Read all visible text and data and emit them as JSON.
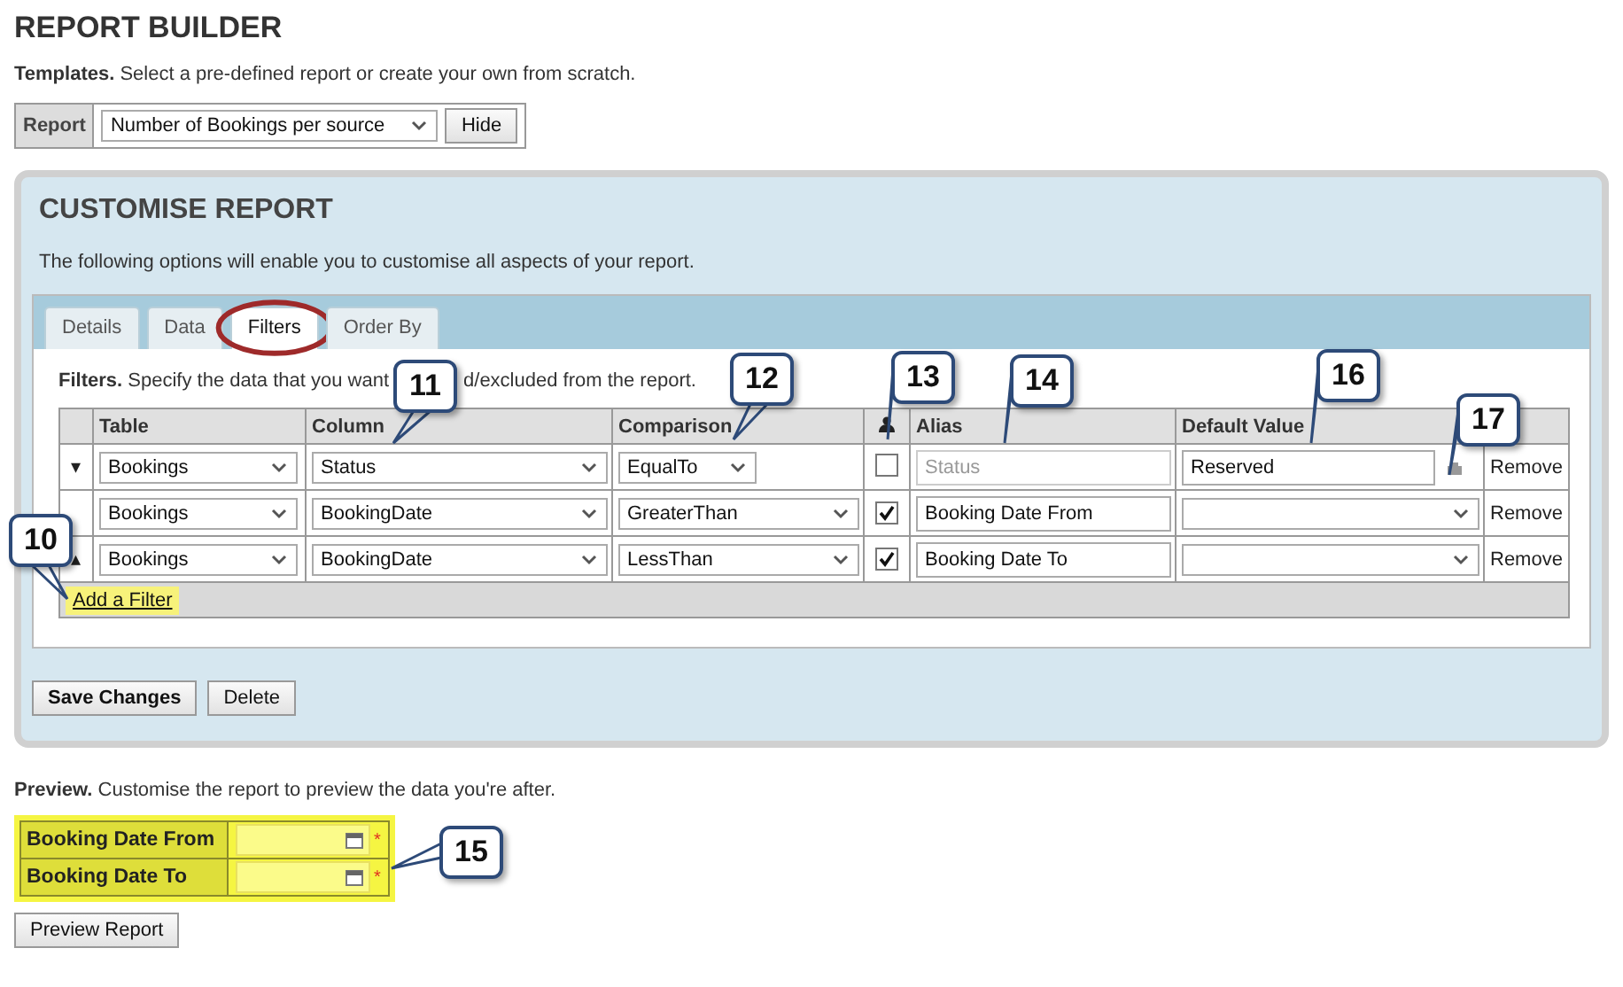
{
  "title": "REPORT BUILDER",
  "templates": {
    "heading": "Templates.",
    "text": "Select a pre-defined report or create your own from scratch.",
    "label": "Report",
    "value": "Number of Bookings per source",
    "button": "Hide"
  },
  "customise": {
    "title": "CUSTOMISE REPORT",
    "description": "The following options will enable you to customise all aspects of your report.",
    "tabs": [
      {
        "label": "Details",
        "selected": false
      },
      {
        "label": "Data",
        "selected": false
      },
      {
        "label": "Filters",
        "selected": true,
        "circled": true
      },
      {
        "label": "Order By",
        "selected": false,
        "circled": false
      }
    ],
    "filters": {
      "heading": "Filters.",
      "description_parts": [
        "Specify the data that you want",
        "d/excluded from the report."
      ],
      "columns": [
        "Table",
        "Column",
        "Comparison",
        "Alias",
        "Default Value"
      ],
      "rows": [
        {
          "move": "▾",
          "table": "Bookings",
          "column": "Status",
          "comparison": "EqualTo",
          "checked": false,
          "alias": {
            "placeholder": "Status"
          },
          "default": {
            "kind": "text",
            "value": "Reserved"
          },
          "remove": "Remove"
        },
        {
          "table": "Bookings",
          "column": "BookingDate",
          "comparison": "GreaterThan",
          "checked": true,
          "alias": {
            "value": "Booking Date From"
          },
          "default": {
            "kind": "select"
          },
          "remove": "Remove"
        },
        {
          "move": "▴",
          "table": "Bookings",
          "column": "BookingDate",
          "comparison": "LessThan",
          "checked": true,
          "alias": {
            "value": "Booking Date To"
          },
          "default": {
            "kind": "select"
          },
          "remove": "Remove"
        }
      ],
      "add_link": "Add a Filter"
    },
    "buttons": [
      "Save Changes",
      "Delete"
    ]
  },
  "preview": {
    "heading": "Preview.",
    "text": "Customise the report to preview the data you're after.",
    "fields": [
      {
        "label": "Booking Date From",
        "marker": "*"
      },
      {
        "label": "Booking Date To",
        "marker": "*"
      }
    ],
    "button": "Preview Report"
  },
  "callouts": [
    "10",
    "11",
    "12",
    "13",
    "14",
    "15",
    "16",
    "17"
  ]
}
